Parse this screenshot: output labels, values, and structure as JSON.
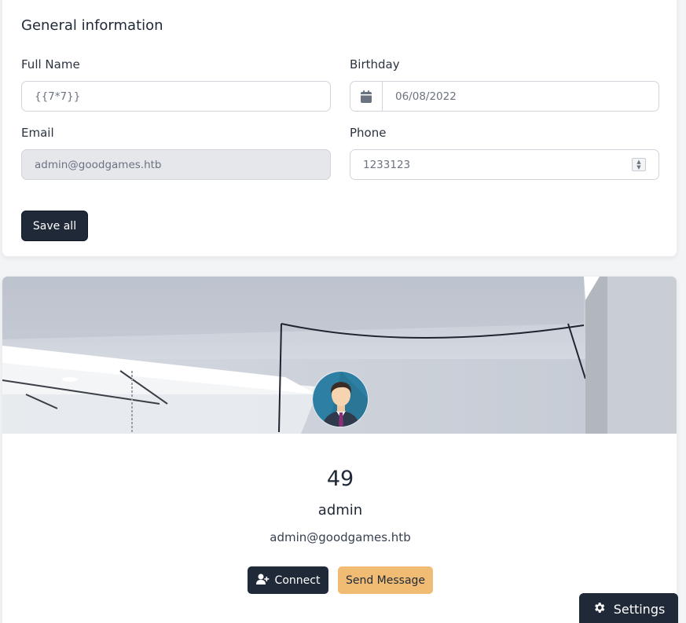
{
  "general": {
    "title": "General information",
    "full_name": {
      "label": "Full Name",
      "value": "{{7*7}}"
    },
    "birthday": {
      "label": "Birthday",
      "value": "06/08/2022"
    },
    "email": {
      "label": "Email",
      "value": "admin@goodgames.htb"
    },
    "phone": {
      "label": "Phone",
      "value": "1233123"
    },
    "save_label": "Save all"
  },
  "profile": {
    "name_result": "49",
    "username": "admin",
    "email": "admin@goodgames.htb",
    "connect_label": "Connect",
    "message_label": "Send Message"
  },
  "settings": {
    "label": "Settings"
  },
  "icons": {
    "calendar": "calendar-icon",
    "stepper": "number-stepper-icon",
    "add_user": "user-plus-icon",
    "gear": "gear-icon",
    "avatar": "businessman-avatar"
  },
  "colors": {
    "primary": "#1f2937",
    "accent": "#f0bc74",
    "background": "#f2f4f6"
  }
}
